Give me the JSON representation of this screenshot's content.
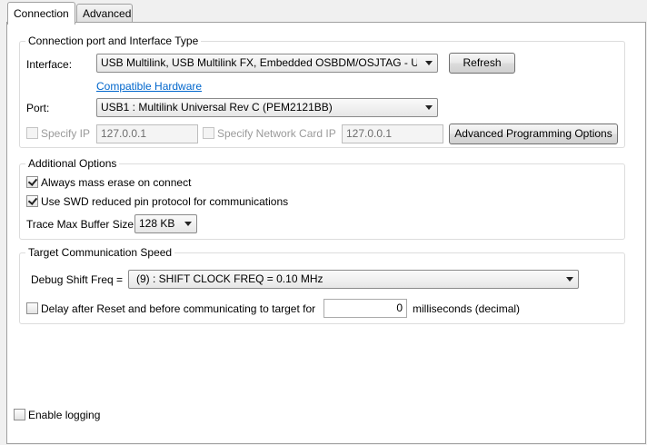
{
  "tabs": [
    {
      "label": "Connection",
      "active": true
    },
    {
      "label": "Advanced",
      "active": false
    }
  ],
  "connection_group": {
    "title": "Connection port and Interface Type",
    "interface_label": "Interface:",
    "interface_value": "USB Multilink, USB Multilink FX, Embedded OSBDM/OSJTAG - USB",
    "refresh_label": "Refresh",
    "compatible_hardware_link": "Compatible Hardware",
    "port_label": "Port:",
    "port_value": "USB1 : Multilink Universal Rev C (PEM2121BB)",
    "specify_ip_label": "Specify IP",
    "specify_ip_checked": false,
    "ip_value": "127.0.0.1",
    "specify_network_card_label": "Specify Network Card IP",
    "specify_network_card_checked": false,
    "network_card_value": "127.0.0.1",
    "advanced_programming_label": "Advanced Programming Options"
  },
  "additional_group": {
    "title": "Additional Options",
    "mass_erase_label": "Always mass erase on connect",
    "mass_erase_checked": true,
    "swd_label": "Use SWD reduced pin protocol for communications",
    "swd_checked": true,
    "trace_label": "Trace Max Buffer Size:",
    "trace_value": "128 KB"
  },
  "speed_group": {
    "title": "Target Communication Speed",
    "debug_shift_label": "Debug Shift Freq =",
    "debug_shift_value": "(9) : SHIFT CLOCK FREQ = 0.10 MHz",
    "delay_label": "Delay after Reset and before communicating to target for",
    "delay_checked": false,
    "delay_value": "0",
    "delay_unit": "milliseconds (decimal)"
  },
  "logging": {
    "label": "Enable logging",
    "checked": false
  },
  "colors": {
    "link": "#0066cc",
    "panel_bg": "#ffffff",
    "window_bg": "#f0f0f0"
  }
}
